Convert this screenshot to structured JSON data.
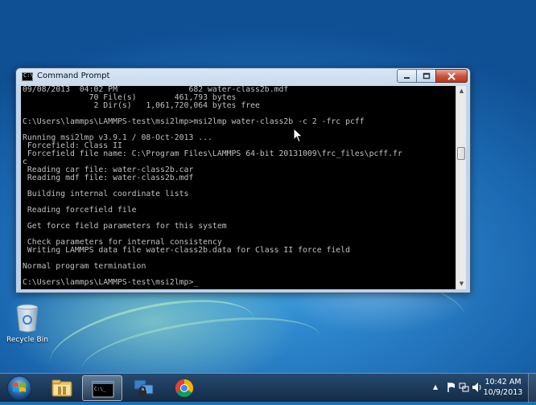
{
  "window": {
    "title": "Command Prompt",
    "icon_label": "C:\\",
    "minimize_icon": "minimize-icon",
    "maximize_icon": "maximize-icon",
    "close_icon": "close-icon"
  },
  "console": {
    "lines": [
      "09/08/2013  04:02 PM               682 water-class2b.mdf",
      "              70 File(s)        461,793 bytes",
      "               2 Dir(s)   1,061,720,064 bytes free",
      "",
      "C:\\Users\\lammps\\LAMMPS-test\\msi2lmp>msi2lmp water-class2b -c 2 -frc pcff",
      "",
      "Running msi2lmp v3.9.1 / 08-Oct-2013 ...",
      " Forcefield: Class II",
      " Forcefield file name: C:\\Program Files\\LAMMPS 64-bit 20131009\\frc_files\\pcff.fr",
      "c",
      " Reading car file: water-class2b.car",
      " Reading mdf file: water-class2b.mdf",
      "",
      " Building internal coordinate lists",
      "",
      " Reading forcefield file",
      "",
      " Get force field parameters for this system",
      "",
      " Check parameters for internal consistency",
      " Writing LAMMPS data file water-class2b.data for Class II force field",
      "",
      "Normal program termination",
      "",
      "C:\\Users\\lammps\\LAMMPS-test\\msi2lmp>"
    ]
  },
  "desktop": {
    "recycle_bin_label": "Recycle Bin"
  },
  "taskbar": {
    "apps": [
      "windows-explorer",
      "command-prompt",
      "network-app",
      "google-chrome"
    ],
    "clock_time": "10:42 AM",
    "clock_date": "10/9/2013",
    "tray_arrow": "▲"
  }
}
